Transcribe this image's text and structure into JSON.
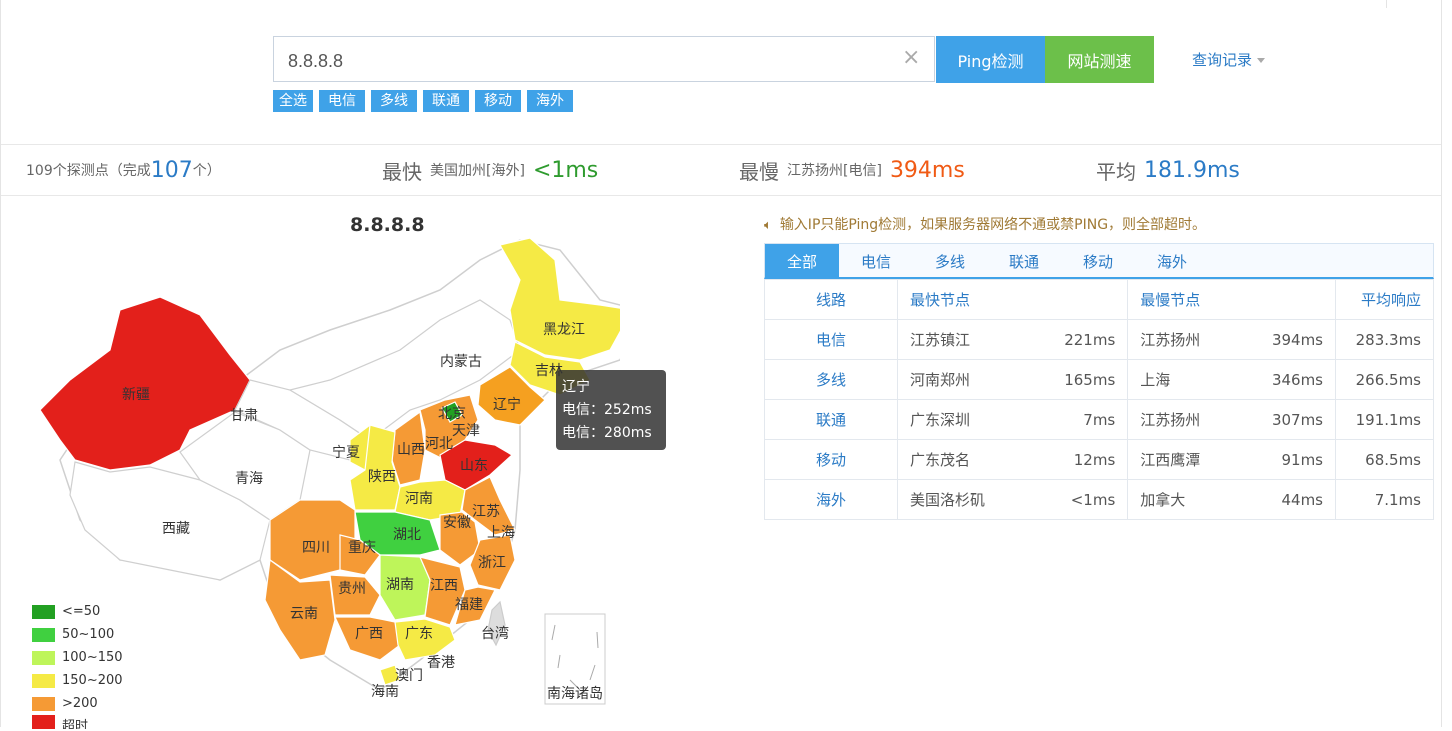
{
  "search": {
    "value": "8.8.8.8",
    "clear_glyph": "×",
    "ping_label": "Ping检测",
    "speed_label": "网站测速",
    "history_label": "查询记录"
  },
  "filters": [
    "全选",
    "电信",
    "多线",
    "联通",
    "移动",
    "海外"
  ],
  "stats": {
    "probe_prefix": "109个探测点（完成",
    "probe_done": "107",
    "probe_suffix": "个）",
    "fast_label": "最快",
    "fast_loc": "美国加州[海外]",
    "fast_val": "<1ms",
    "slow_label": "最慢",
    "slow_loc": "江苏扬州[电信]",
    "slow_val": "394ms",
    "avg_label": "平均",
    "avg_val": "181.9ms"
  },
  "map": {
    "title": "8.8.8.8",
    "tooltip": {
      "province": "辽宁",
      "line1": "电信：252ms",
      "line2": "电信：280ms"
    },
    "legend": [
      {
        "label": "<=50",
        "color": "#22a022"
      },
      {
        "label": "50~100",
        "color": "#40d040"
      },
      {
        "label": "100~150",
        "color": "#bef55a"
      },
      {
        "label": "150~200",
        "color": "#f5ea45"
      },
      {
        "label": ">200",
        "color": "#f59a35"
      },
      {
        "label": "超时",
        "color": "#e3201b"
      }
    ],
    "provinces": {
      "xinjiang": "新疆",
      "xizang": "西藏",
      "qinghai": "青海",
      "gansu": "甘肃",
      "neimenggu": "内蒙古",
      "heilongjiang": "黑龙江",
      "jilin": "吉林",
      "liaoning": "辽宁",
      "beijing": "北京",
      "tianjin": "天津",
      "hebei": "河北",
      "shanxi": "山西",
      "shandong": "山东",
      "ningxia": "宁夏",
      "shaanxi": "陕西",
      "henan": "河南",
      "jiangsu": "江苏",
      "anhui": "安徽",
      "shanghai": "上海",
      "hubei": "湖北",
      "sichuan": "四川",
      "chongqing": "重庆",
      "zhejiang": "浙江",
      "guizhou": "贵州",
      "hunan": "湖南",
      "jiangxi": "江西",
      "fujian": "福建",
      "yunnan": "云南",
      "guangxi": "广西",
      "guangdong": "广东",
      "taiwan": "台湾",
      "xianggang": "香港",
      "aomen": "澳门",
      "hainan": "海南",
      "nanhai": "南海诸岛"
    }
  },
  "notice": "输入IP只能Ping检测，如果服务器网络不通或禁PING，则全部超时。",
  "tabs": [
    "全部",
    "电信",
    "多线",
    "联通",
    "移动",
    "海外"
  ],
  "table": {
    "headers": {
      "line": "线路",
      "fast": "最快节点",
      "slow": "最慢节点",
      "avg": "平均响应"
    },
    "rows": [
      {
        "line": "电信",
        "fast_node": "江苏镇江",
        "fast_ms": "221ms",
        "slow_node": "江苏扬州",
        "slow_ms": "394ms",
        "avg": "283.3ms"
      },
      {
        "line": "多线",
        "fast_node": "河南郑州",
        "fast_ms": "165ms",
        "slow_node": "上海",
        "slow_ms": "346ms",
        "avg": "266.5ms"
      },
      {
        "line": "联通",
        "fast_node": "广东深圳",
        "fast_ms": "7ms",
        "slow_node": "江苏扬州",
        "slow_ms": "307ms",
        "avg": "191.1ms"
      },
      {
        "line": "移动",
        "fast_node": "广东茂名",
        "fast_ms": "12ms",
        "slow_node": "江西鹰潭",
        "slow_ms": "91ms",
        "avg": "68.5ms"
      },
      {
        "line": "海外",
        "fast_node": "美国洛杉矶",
        "fast_ms": "<1ms",
        "slow_node": "加拿大",
        "slow_ms": "44ms",
        "avg": "7.1ms"
      }
    ]
  },
  "colors": {
    "accent": "#3fa2e8",
    "green_btn": "#6cc04a",
    "fast": "#2e9b2e",
    "slow": "#f05a14",
    "avg": "#2b7bc6"
  }
}
